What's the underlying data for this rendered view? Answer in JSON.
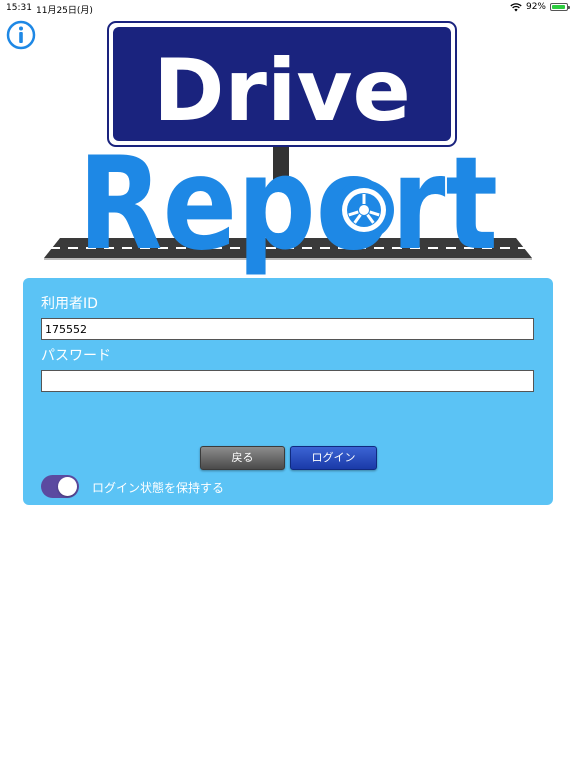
{
  "status_bar": {
    "time": "15:31",
    "date": "11月25日(月)",
    "battery": "92%",
    "battery_level": 0.92
  },
  "logo": {
    "line1": "Drive",
    "line2": "Report"
  },
  "form": {
    "user_id_label": "利用者ID",
    "user_id_value": "175552",
    "password_label": "パスワード",
    "password_value": "",
    "back_label": "戻る",
    "login_label": "ログイン",
    "keep_login_label": "ログイン状態を保持する",
    "keep_login_on": true
  },
  "colors": {
    "panel": "#5bc3f5",
    "sign_blue": "#1a237e",
    "report_blue": "#1e88e5",
    "toggle_on": "#5b4aa0",
    "login_button": "#1a3aa8",
    "back_button": "#5a5a5a"
  }
}
